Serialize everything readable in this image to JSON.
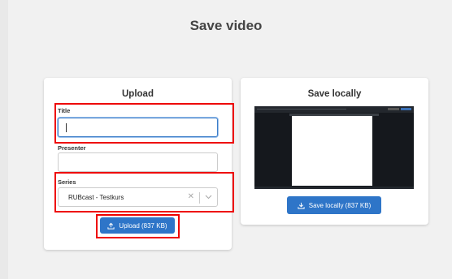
{
  "page": {
    "title": "Save video"
  },
  "upload": {
    "heading": "Upload",
    "title_label": "Title",
    "title_value": "",
    "presenter_label": "Presenter",
    "presenter_value": "",
    "series_label": "Series",
    "series_value": "RUBcast - Testkurs",
    "button_label": "Upload (837 KB)"
  },
  "local": {
    "heading": "Save locally",
    "button_label": "Save locally (837 KB)"
  },
  "colors": {
    "accent": "#2e75c8",
    "highlight": "#e00000",
    "background": "#f1f1f1"
  },
  "icons": [
    "upload-icon",
    "download-icon",
    "clear-icon",
    "chevron-down-icon"
  ]
}
